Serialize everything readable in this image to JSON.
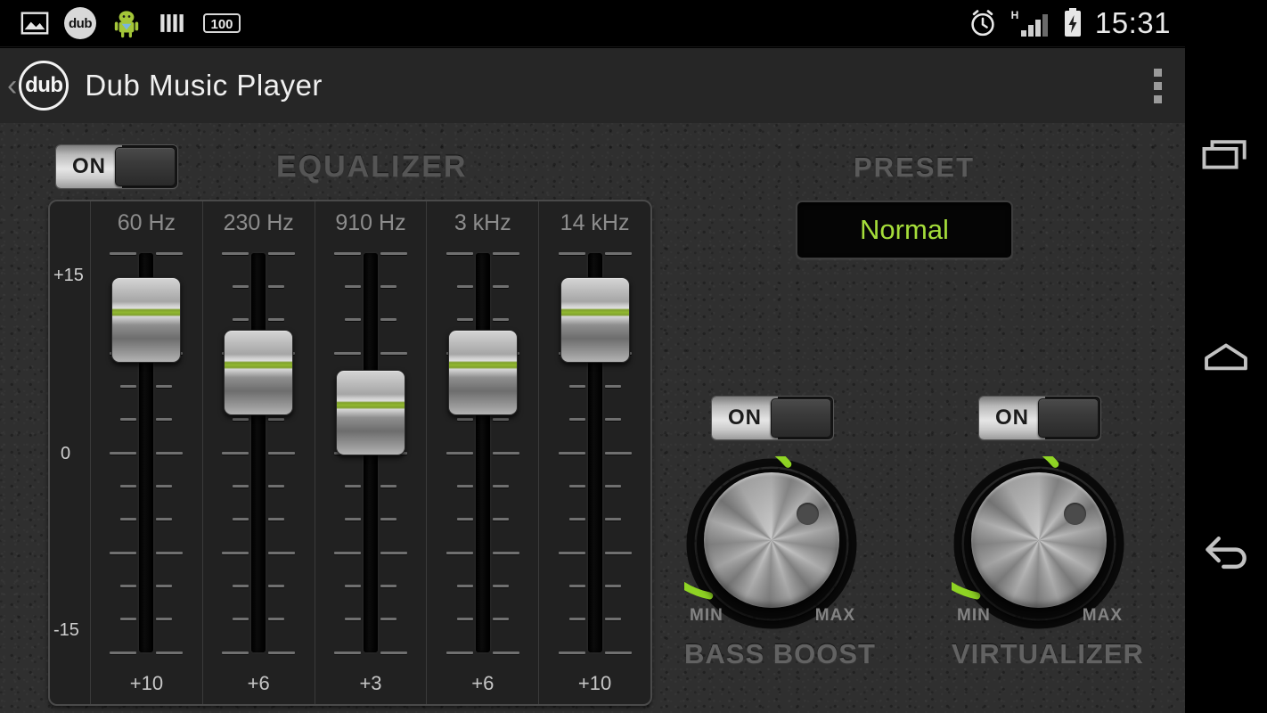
{
  "statusbar": {
    "icons": [
      "image-icon",
      "dub-app-icon",
      "android-icon",
      "sim-toolkit-icon",
      "battery-100-icon"
    ],
    "dub_icon_label": "dub",
    "battery_badge": "100",
    "right_icons": [
      "alarm-icon",
      "hspa-signal-icon",
      "battery-charging-icon"
    ],
    "network_type": "H",
    "clock": "15:31"
  },
  "actionbar": {
    "back_label": "‹",
    "logo_text": "dub",
    "title": "Dub Music Player",
    "overflow_label": "overflow-menu"
  },
  "equalizer": {
    "section_title": "EQUALIZER",
    "toggle_label": "ON",
    "toggle_state": "on",
    "scale": {
      "top": "+15",
      "mid": "0",
      "bottom": "-15"
    },
    "bands": [
      {
        "freq": "60 Hz",
        "value": "+10",
        "pos_pct": 16.7
      },
      {
        "freq": "230 Hz",
        "value": "+6",
        "pos_pct": 30.0
      },
      {
        "freq": "910 Hz",
        "value": "+3",
        "pos_pct": 40.0
      },
      {
        "freq": "3 kHz",
        "value": "+6",
        "pos_pct": 30.0
      },
      {
        "freq": "14 kHz",
        "value": "+10",
        "pos_pct": 16.7
      }
    ]
  },
  "preset": {
    "section_title": "PRESET",
    "selected": "Normal"
  },
  "bass_boost": {
    "caption": "BASS BOOST",
    "toggle_label": "ON",
    "toggle_state": "on",
    "min_label": "MIN",
    "max_label": "MAX",
    "arc_pct": 78
  },
  "virtualizer": {
    "caption": "VIRTUALIZER",
    "toggle_label": "ON",
    "toggle_state": "on",
    "min_label": "MIN",
    "max_label": "MAX",
    "arc_pct": 78
  },
  "navbar": {
    "recents_label": "recents",
    "home_label": "home",
    "back_label": "back"
  },
  "colors": {
    "accent_green": "#a5dd3a",
    "knob_arc_green": "#8fd424",
    "leather_bg": "#2f2f2f",
    "panel_bg": "#212121",
    "actionbar_bg": "#262626"
  }
}
